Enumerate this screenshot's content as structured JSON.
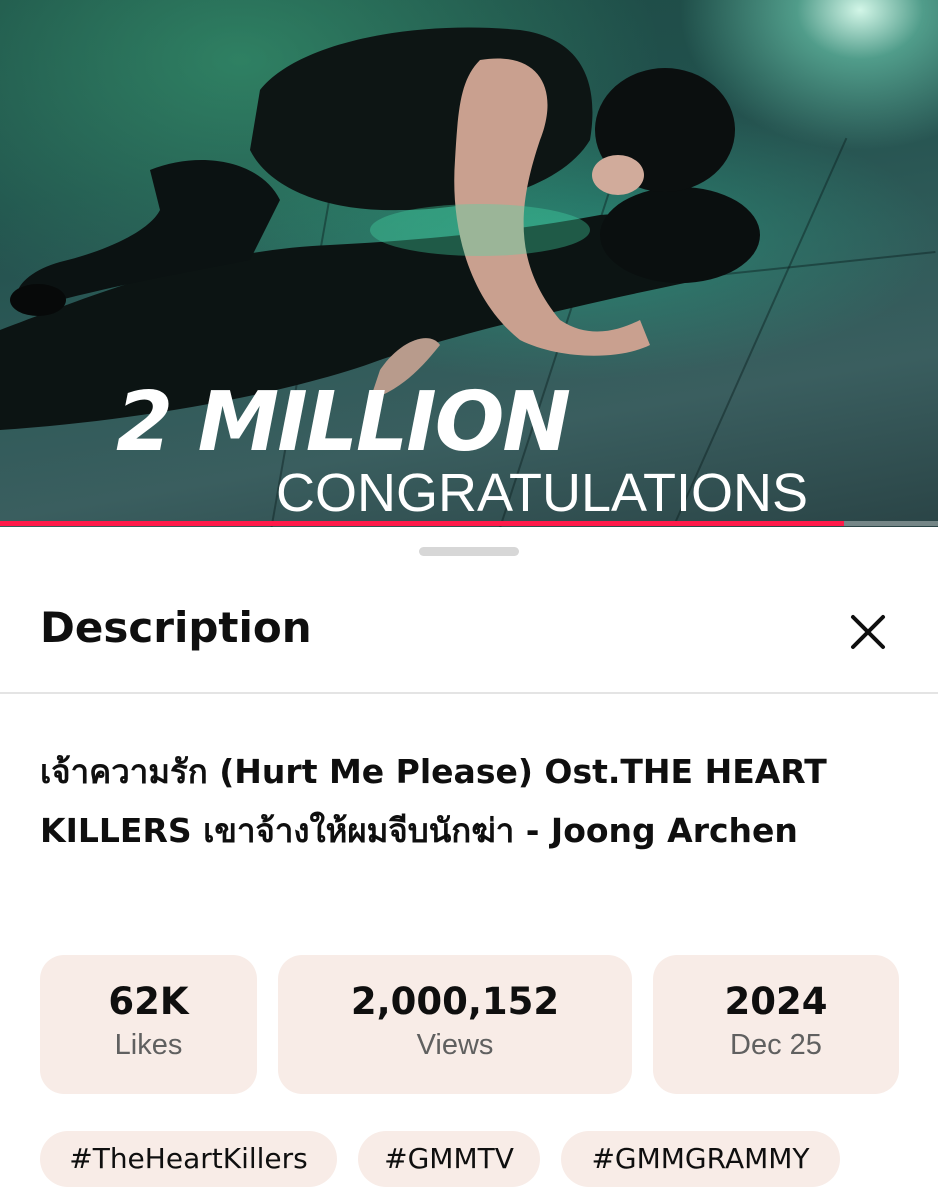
{
  "video": {
    "overlay_headline": "2 MILLION",
    "overlay_subheadline": "CONGRATULATIONS",
    "progress_fraction": 0.9
  },
  "sheet": {
    "title": "Description",
    "close_icon": "close-icon"
  },
  "video_title": "เจ้าความรัก (Hurt Me Please) Ost.THE HEART KILLERS เขาจ้างให้ผมจีบนักฆ่า - Joong Archen",
  "stats": {
    "likes": {
      "value": "62K",
      "label": "Likes"
    },
    "views": {
      "value": "2,000,152",
      "label": "Views"
    },
    "date": {
      "value": "2024",
      "label": "Dec 25"
    }
  },
  "hashtags": [
    "#TheHeartKillers",
    "#GMMTV",
    "#GMMGRAMMY"
  ],
  "colors": {
    "progress": "#ff1a4a",
    "chip_background": "#f8ece7",
    "text_primary": "#0f0f0f",
    "text_secondary": "#606060"
  }
}
